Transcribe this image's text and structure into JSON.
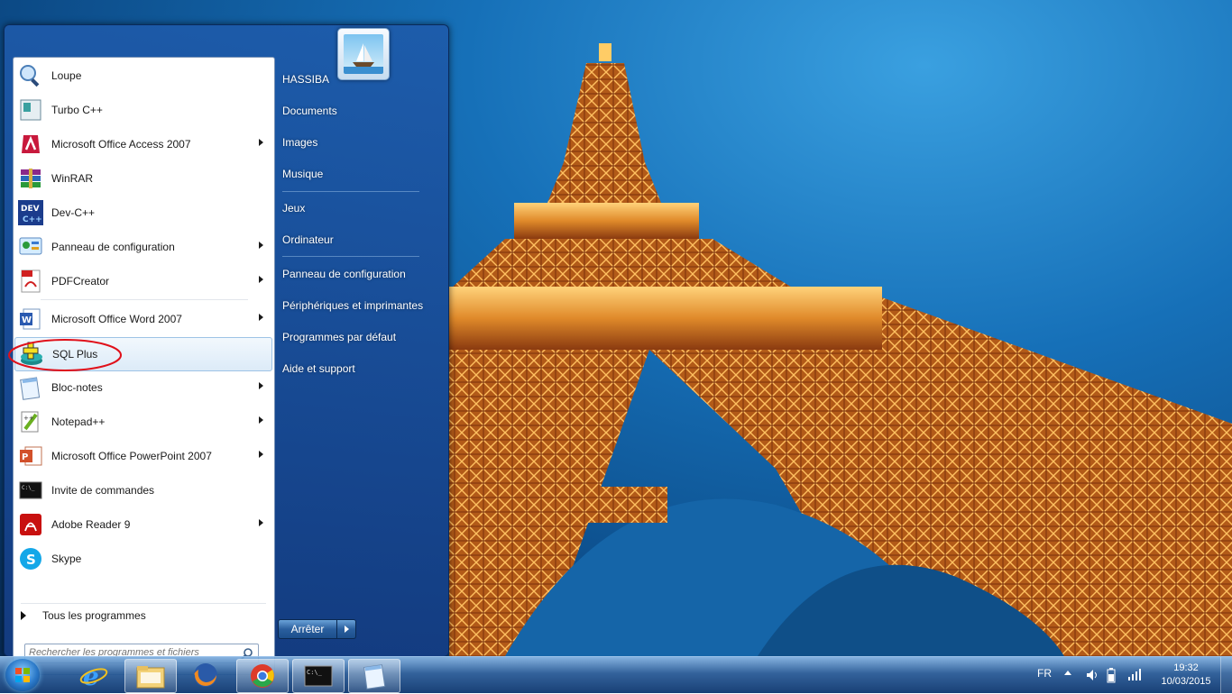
{
  "start_menu": {
    "programs": [
      {
        "label": "Loupe",
        "icon": "magnifier-icon",
        "has_submenu": false
      },
      {
        "label": "Turbo C++",
        "icon": "turbo-cpp-icon",
        "has_submenu": false
      },
      {
        "label": "Microsoft Office Access 2007",
        "icon": "access-icon",
        "has_submenu": true
      },
      {
        "label": "WinRAR",
        "icon": "winrar-icon",
        "has_submenu": false
      },
      {
        "label": "Dev-C++",
        "icon": "devcpp-icon",
        "has_submenu": false
      },
      {
        "label": "Panneau de configuration",
        "icon": "control-panel-icon",
        "has_submenu": true
      },
      {
        "label": "PDFCreator",
        "icon": "pdfcreator-icon",
        "has_submenu": true
      },
      {
        "label": "Microsoft Office Word 2007",
        "icon": "word-icon",
        "has_submenu": true
      },
      {
        "label": "SQL Plus",
        "icon": "sqlplus-icon",
        "has_submenu": false,
        "highlighted": true
      },
      {
        "label": "Bloc-notes",
        "icon": "notepad-icon",
        "has_submenu": true
      },
      {
        "label": "Notepad++",
        "icon": "notepadpp-icon",
        "has_submenu": true
      },
      {
        "label": "Microsoft Office PowerPoint 2007",
        "icon": "powerpoint-icon",
        "has_submenu": true
      },
      {
        "label": "Invite de commandes",
        "icon": "cmd-icon",
        "has_submenu": false
      },
      {
        "label": "Adobe Reader 9",
        "icon": "adobe-reader-icon",
        "has_submenu": true
      },
      {
        "label": "Skype",
        "icon": "skype-icon",
        "has_submenu": false
      }
    ],
    "all_programs_label": "Tous les programmes",
    "search_placeholder": "Rechercher les programmes et fichiers",
    "right_items": [
      "HASSIBA",
      "Documents",
      "Images",
      "Musique",
      "Jeux",
      "Ordinateur",
      "Panneau de configuration",
      "Périphériques et imprimantes",
      "Programmes par défaut",
      "Aide et support"
    ],
    "shutdown_label": "Arrêter"
  },
  "taskbar": {
    "pinned": [
      "internet-explorer-icon",
      "explorer-folder-icon",
      "firefox-icon",
      "chrome-icon",
      "cmd-icon",
      "notepad-icon"
    ],
    "language": "FR",
    "time": "19:32",
    "date": "10/03/2015"
  },
  "colors": {
    "accent": "#1c4f8c",
    "highlight_ring": "#e0101a"
  }
}
